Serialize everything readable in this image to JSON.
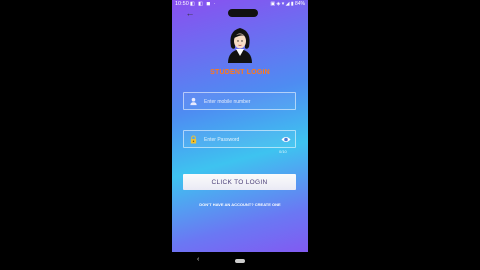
{
  "status_bar": {
    "time": "10:50",
    "left_icons": "◧ ◧ ◼ ·",
    "right_status": "▣ ◈ ▾ ◢ ▮ 84%"
  },
  "icons": {
    "back": "←",
    "eye": "eye-icon",
    "lock": "lock-icon",
    "person": "person-icon"
  },
  "login": {
    "title": "STUDENT LOGIN",
    "mobile_placeholder": "Enter mobile number",
    "password_placeholder": "Enter Password",
    "password_counter": "0/10",
    "button_label": "CLICK TO LOGIN",
    "signup_text": "DON'T HAVE AN ACCOUNT? CREATE ONE"
  },
  "nav": {
    "back": "‹"
  },
  "colors": {
    "title": "#ff7a1a",
    "gradient_top": "#8a4ff0",
    "gradient_mid": "#3ec3f0",
    "gradient_bottom": "#8b4ef2",
    "lock": "#f2c230"
  }
}
